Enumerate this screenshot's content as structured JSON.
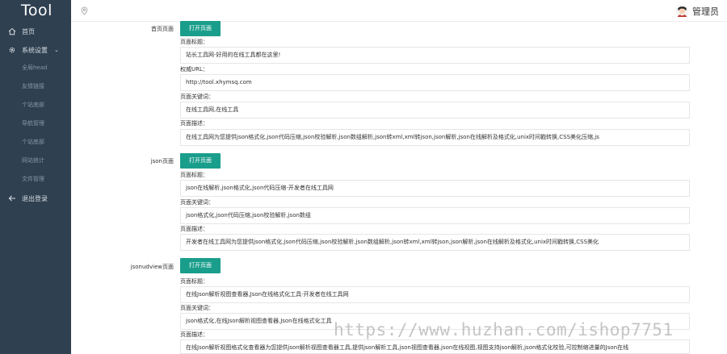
{
  "app": {
    "logo": "Tool",
    "user_name": "管理员"
  },
  "sidebar": {
    "home": "首页",
    "settings": "系统设置",
    "sub_items": [
      "全局head",
      "友情链接",
      "个站底部",
      "导航管理",
      "个站底部",
      "网站统计",
      "文件管理"
    ],
    "logout": "退出登录"
  },
  "sections": [
    {
      "label": "首页页面",
      "button": "打开页面",
      "fields": [
        {
          "label": "页面标题：",
          "value": "站长工具网-好用的在线工具都在这里!"
        },
        {
          "label": "权威URL：",
          "value": "http://tool.xhymsq.com"
        },
        {
          "label": "页面关键词：",
          "value": "在线工具网,在线工具"
        },
        {
          "label": "页面描述：",
          "value": "在线工具网为您提供json格式化,json代码压缩,json校验解析,json数组解析,json转xml,xml转json,json解析,json在线解析及格式化,unix时间戳转换,CSS美化压缩,js"
        }
      ]
    },
    {
      "label": "json页面",
      "button": "打开页面",
      "fields": [
        {
          "label": "页面标题：",
          "value": "json在线解析,json格式化,json代码压缩-开发者在线工具网"
        },
        {
          "label": "页面关键词：",
          "value": "json格式化,json代码压缩,json校验解析,json数组"
        },
        {
          "label": "页面描述：",
          "value": "开发者在线工具网为您提供json格式化,json代码压缩,json校验解析,json数组解析,json转xml,xml转json,json解析,json在线解析及格式化,unix时间戳转换,CSS美化"
        }
      ]
    },
    {
      "label": "jsonudview页面",
      "button": "打开页面",
      "fields": [
        {
          "label": "页面标题：",
          "value": "在线Json解析视图查看器,Json在线格式化工具-开发者在线工具网"
        },
        {
          "label": "页面关键词：",
          "value": "json格式化,在线Json解析视图查看器,Json在线格式化工具"
        },
        {
          "label": "页面描述：",
          "value": "在线Json解析视图格式化查看器为您提供json解析视图查看器工具,提供json解析工具,json视图查看器,json在线视图,视图支持json解析,json格式化校验,可控制缩进量的Json在线"
        }
      ]
    }
  ],
  "watermark": "https://www.huzhan.com/ishop7751",
  "colors": {
    "sidebar_bg": "#2f4050",
    "button_bg": "#1a9e8c"
  }
}
